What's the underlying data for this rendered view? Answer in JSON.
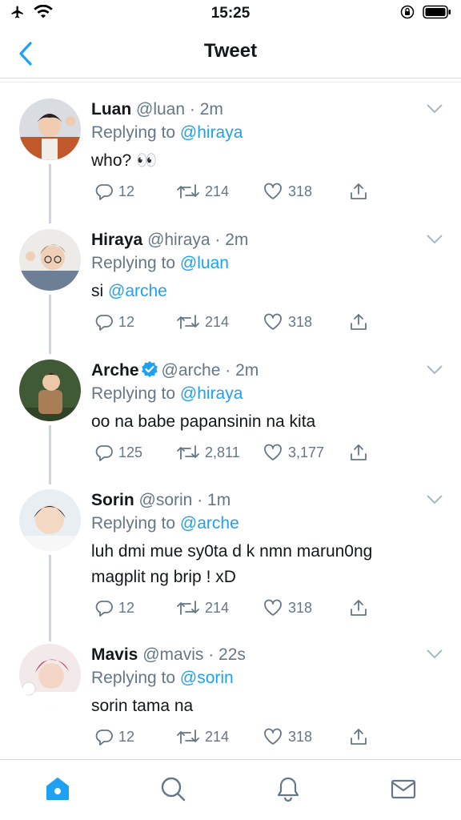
{
  "status_bar": {
    "time": "15:25"
  },
  "header": {
    "title": "Tweet"
  },
  "tweets": [
    {
      "name": "Luan",
      "handle": "@luan",
      "time": "2m",
      "replying_prefix": "Replying to ",
      "replying_to": "@hiraya",
      "text": "who? 👀",
      "replies": "12",
      "retweets": "214",
      "likes": "318"
    },
    {
      "name": "Hiraya",
      "handle": "@hiraya",
      "time": "2m",
      "replying_prefix": "Replying to ",
      "replying_to": "@luan",
      "text_prefix": "si ",
      "text_mention": "@arche",
      "replies": "12",
      "retweets": "214",
      "likes": "318"
    },
    {
      "name": "Arche",
      "handle": "@arche",
      "time": "2m",
      "verified": true,
      "replying_prefix": "Replying to ",
      "replying_to": "@hiraya",
      "text": "oo na babe papansinin na kita",
      "replies": "125",
      "retweets": "2,811",
      "likes": "3,177"
    },
    {
      "name": "Sorin",
      "handle": "@sorin",
      "time": "1m",
      "replying_prefix": "Replying to ",
      "replying_to": "@arche",
      "text": "luh dmi mue sy0ta d k nmn marun0ng magplit ng brip ! xD",
      "replies": "12",
      "retweets": "214",
      "likes": "318"
    },
    {
      "name": "Mavis",
      "handle": "@mavis",
      "time": "22s",
      "replying_prefix": "Replying to ",
      "replying_to": "@sorin",
      "text": "sorin tama na",
      "replies": "12",
      "retweets": "214",
      "likes": "318"
    }
  ],
  "tabbar": {
    "items": [
      "home-icon",
      "search-icon",
      "notifications-icon",
      "messages-icon"
    ]
  },
  "colors": {
    "accent": "#1da1f2",
    "muted": "#657786",
    "text": "#14171a",
    "divider": "#e6ecf0"
  }
}
